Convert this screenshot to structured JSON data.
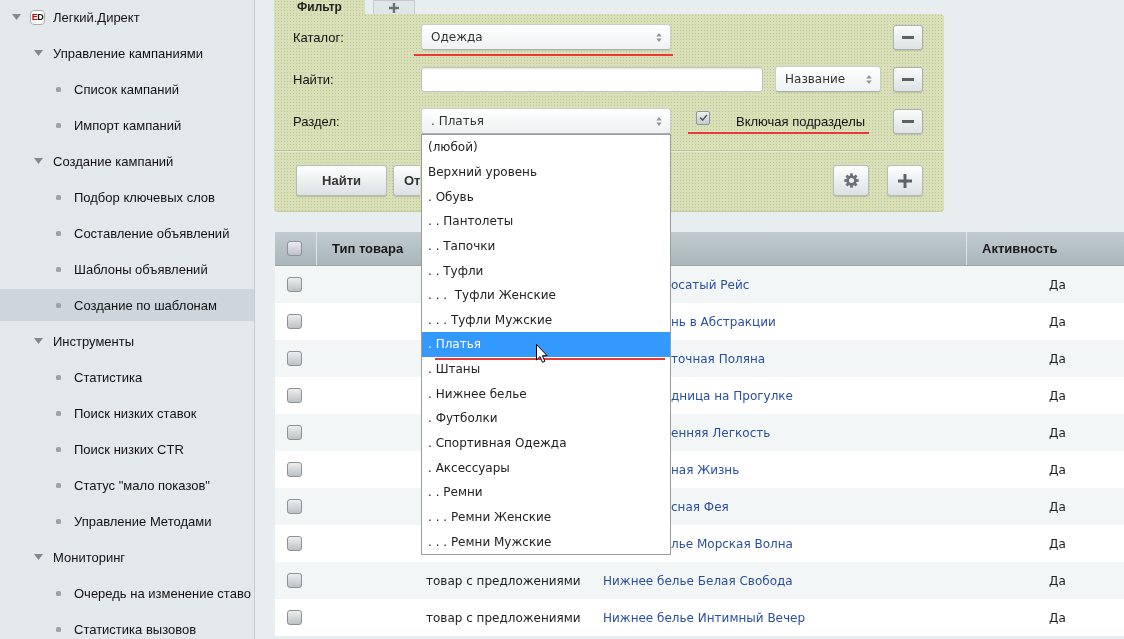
{
  "sidebar": {
    "items": [
      {
        "label": "Легкий.Директ",
        "logo": "ED",
        "expanded": true,
        "selected": false,
        "children": [
          {
            "label": "Управление кампаниями",
            "expanded": true,
            "selected": false,
            "children": [
              {
                "label": "Список кампаний",
                "selected": false
              },
              {
                "label": "Импорт кампаний",
                "selected": false
              }
            ]
          },
          {
            "label": "Создание кампаний",
            "expanded": true,
            "selected": false,
            "children": [
              {
                "label": "Подбор ключевых слов",
                "selected": false
              },
              {
                "label": "Составление объявлений",
                "selected": false
              },
              {
                "label": "Шаблоны объявлений",
                "selected": false
              },
              {
                "label": "Создание по шаблонам",
                "selected": true
              }
            ]
          },
          {
            "label": "Инструменты",
            "expanded": true,
            "selected": false,
            "children": [
              {
                "label": "Статистика",
                "selected": false
              },
              {
                "label": "Поиск низких ставок",
                "selected": false
              },
              {
                "label": "Поиск низких CTR",
                "selected": false
              },
              {
                "label": "Статус \"мало показов\"",
                "selected": false
              },
              {
                "label": "Управление Методами",
                "selected": false
              }
            ]
          },
          {
            "label": "Мониторинг",
            "expanded": true,
            "selected": false,
            "children": [
              {
                "label": "Очередь на изменение ставо",
                "selected": false
              },
              {
                "label": "Статистика вызовов",
                "selected": false
              }
            ]
          }
        ]
      }
    ]
  },
  "filter": {
    "tabs": [
      {
        "kind": "label",
        "label": "Фильтр",
        "selected": true
      },
      {
        "kind": "add",
        "selected": false
      }
    ],
    "rows": [
      {
        "kind": "select",
        "label": "Каталог:",
        "value": "Одежда",
        "underlined": true
      },
      {
        "kind": "search",
        "label": "Найти:",
        "field": "Название",
        "underlined": false
      },
      {
        "kind": "section",
        "label": "Раздел:",
        "value": ". Платья",
        "underlined": false,
        "expanded": true,
        "checkbox": {
          "label": "Включая подразделы",
          "checked": true,
          "underlined": true
        },
        "options": [
          {
            "label": "(любой)",
            "selected": false,
            "underlined": false
          },
          {
            "label": "Верхний уровень",
            "selected": false,
            "underlined": false
          },
          {
            "label": ". Обувь",
            "selected": false,
            "underlined": false
          },
          {
            "label": ". . Пантолеты",
            "selected": false,
            "underlined": false
          },
          {
            "label": ". . Тапочки",
            "selected": false,
            "underlined": false
          },
          {
            "label": ". . Туфли",
            "selected": false,
            "underlined": false
          },
          {
            "label": ". . .  Туфли Женские",
            "selected": false,
            "underlined": false
          },
          {
            "label": ". . . Туфли Мужские",
            "selected": false,
            "underlined": false
          },
          {
            "label": ". Платья",
            "selected": true,
            "underlined": true
          },
          {
            "label": ". Штаны",
            "selected": false,
            "underlined": false
          },
          {
            "label": ". Нижнее белье",
            "selected": false,
            "underlined": false
          },
          {
            "label": ". Футболки",
            "selected": false,
            "underlined": false
          },
          {
            "label": ". Спортивная Одежда",
            "selected": false,
            "underlined": false
          },
          {
            "label": ". Аксессуары",
            "selected": false,
            "underlined": false
          },
          {
            "label": ". . Ремни",
            "selected": false,
            "underlined": false
          },
          {
            "label": ". . . Ремни Женские",
            "selected": false,
            "underlined": false
          },
          {
            "label": ". . . Ремни Мужские",
            "selected": false,
            "underlined": false
          }
        ]
      }
    ],
    "buttons": [
      {
        "kind": "text",
        "label": "Найти"
      },
      {
        "kind": "text",
        "label": "От"
      },
      {
        "kind": "settings"
      },
      {
        "kind": "add"
      }
    ]
  },
  "table": {
    "columns": [
      {
        "kind": "checkbox",
        "checked": false
      },
      {
        "kind": "label",
        "label": "Тип товара"
      },
      {
        "kind": "blank"
      },
      {
        "kind": "blank"
      },
      {
        "kind": "label",
        "label": "Активность"
      }
    ],
    "rows": [
      {
        "checked": false,
        "name": "осатый Рейс",
        "active": "Да"
      },
      {
        "checked": false,
        "name": "нь в Абстракции",
        "active": "Да"
      },
      {
        "checked": false,
        "name": "точная Поляна",
        "active": "Да"
      },
      {
        "checked": false,
        "name": "дница на Прогулке",
        "active": "Да"
      },
      {
        "checked": false,
        "name": "енняя Легкость",
        "active": "Да"
      },
      {
        "checked": false,
        "name": "ная Жизнь",
        "active": "Да"
      },
      {
        "checked": false,
        "name": "сная Фея",
        "active": "Да"
      },
      {
        "checked": false,
        "name": "лье Морская Волна",
        "active": "Да"
      },
      {
        "checked": false,
        "type": "товар с предложениями",
        "name": "Нижнее белье Белая Свобода",
        "active": "Да"
      },
      {
        "checked": false,
        "type": "товар с предложениями",
        "name": "Нижнее белье Интимный Вечер",
        "active": "Да"
      }
    ]
  }
}
